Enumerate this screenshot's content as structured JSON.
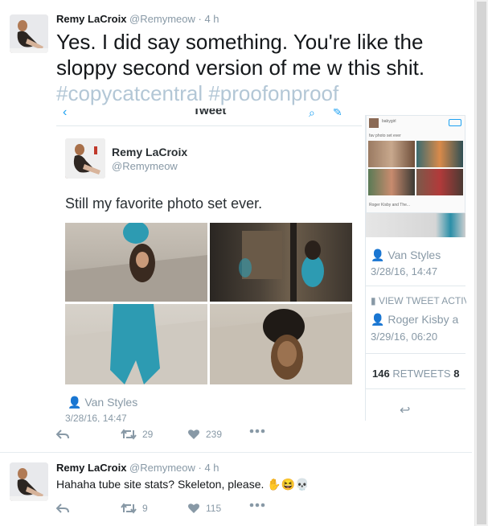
{
  "tweets": [
    {
      "name": "Remy LaCroix",
      "handle": "@Remymeow",
      "separator": "·",
      "time": "4 h",
      "text": "Yes. I did say something. You're like the sloppy second version of me w this shit.",
      "hashtags": "#copycatcentral #proofonproof",
      "embed": {
        "title": "Tweet",
        "name": "Remy LaCroix",
        "handle": "@Remymeow",
        "text": "Still my favorite photo set ever.",
        "location": "Van Styles",
        "date": "3/28/16, 14:47",
        "side": {
          "mini_handle": "babygirl",
          "mini_caption": "fav photo set ever",
          "mini_footer": "Roger Kisby and The...",
          "location": "Van Styles",
          "date": "3/28/16, 14:47",
          "activity": "VIEW TWEET ACTIVITY",
          "retweeter": "Roger Kisby a",
          "retweet_date": "3/29/16, 06:20",
          "retweets_count": "146",
          "retweets_label": "RETWEETS",
          "likes_partial": "8"
        }
      },
      "actions": {
        "retweets": "29",
        "likes": "239"
      }
    },
    {
      "name": "Remy LaCroix",
      "handle": "@Remymeow",
      "separator": "·",
      "time": "4 h",
      "text": "Hahaha tube site stats? Skeleton, please.",
      "emojis": "✋😆💀",
      "actions": {
        "retweets": "9",
        "likes": "115"
      }
    }
  ],
  "colors": {
    "accent": "#1da1f2",
    "muted": "#8899a6",
    "hashtag": "#b3c7d6",
    "leggings": "#2d9bb2"
  }
}
